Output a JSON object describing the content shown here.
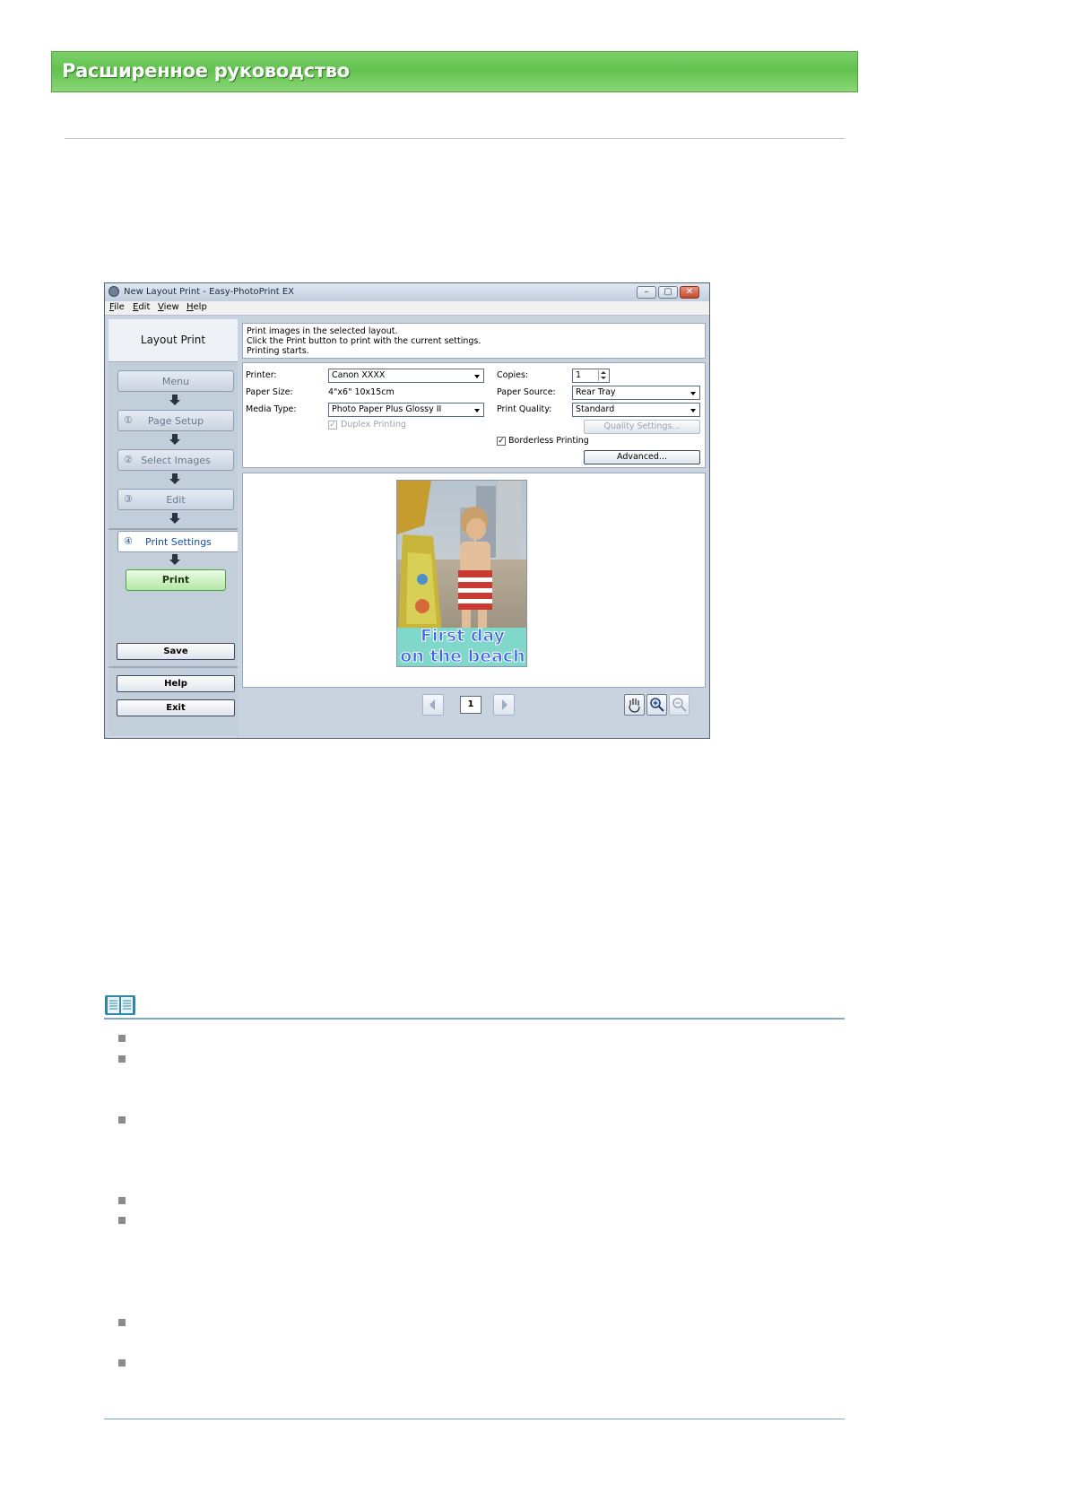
{
  "page": {
    "header_title": "Расширенное руководство"
  },
  "window": {
    "title": "New Layout Print - Easy-PhotoPrint EX",
    "controls": {
      "minimize": "–",
      "restore": "▢",
      "close": "✕"
    },
    "menu": [
      "File",
      "Edit",
      "View",
      "Help"
    ]
  },
  "left_panel": {
    "heading": "Layout Print",
    "steps": [
      {
        "num": "",
        "label": "Menu"
      },
      {
        "num": "①",
        "label": "Page Setup"
      },
      {
        "num": "②",
        "label": "Select Images"
      },
      {
        "num": "③",
        "label": "Edit"
      }
    ],
    "active_step": {
      "num": "④",
      "label": "Print Settings"
    },
    "print_label": "Print",
    "save_label": "Save",
    "help_label": "Help",
    "exit_label": "Exit"
  },
  "info": {
    "lines": [
      "Print images in the selected layout.",
      "Click the Print button to print with the current settings.",
      "Printing starts."
    ]
  },
  "settings": {
    "printer_label": "Printer:",
    "printer_value": "Canon XXXX",
    "paper_size_label": "Paper Size:",
    "paper_size_value": "4\"x6\" 10x15cm",
    "media_type_label": "Media Type:",
    "media_type_value": "Photo Paper Plus Glossy II",
    "duplex_label": "Duplex Printing",
    "duplex_checked": true,
    "copies_label": "Copies:",
    "copies_value": "1",
    "paper_source_label": "Paper Source:",
    "paper_source_value": "Rear Tray",
    "print_quality_label": "Print Quality:",
    "print_quality_value": "Standard",
    "quality_settings_label": "Quality Settings...",
    "borderless_label": "Borderless Printing",
    "borderless_checked": true,
    "advanced_label": "Advanced..."
  },
  "preview": {
    "caption_line1": "First day",
    "caption_line2": "on the beach",
    "page_number": "1"
  },
  "colors": {
    "header_green": "#62c24f",
    "window_frame": "#c9d3df",
    "rule_blue": "#7ca9c5",
    "caption_blue": "#2f5fe0"
  },
  "icons": {
    "prev": "prev-page-icon",
    "next": "next-page-icon",
    "hand": "hand-tool-icon",
    "zoom_in": "zoom-in-icon",
    "zoom_out": "zoom-out-icon",
    "note": "note-book-icon"
  }
}
